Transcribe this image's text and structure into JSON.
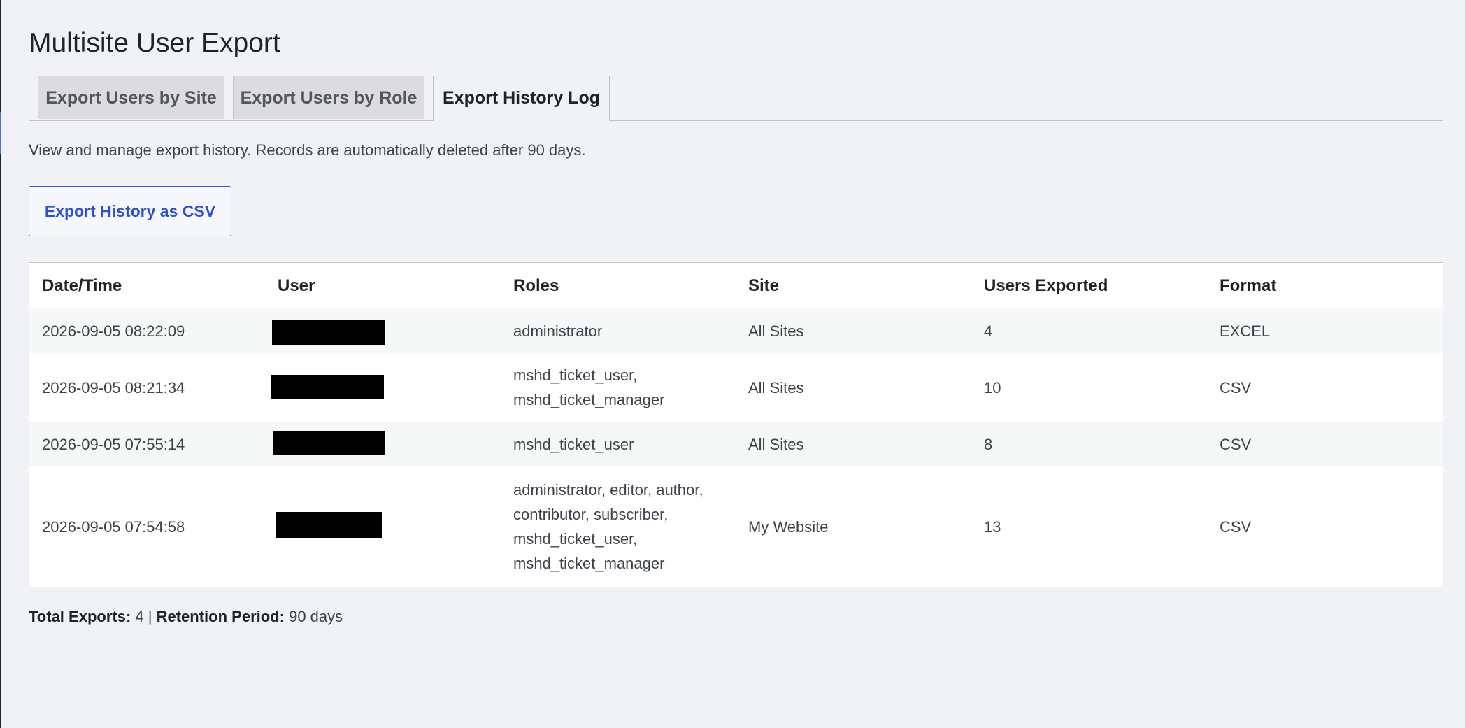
{
  "page_title": "Multisite User Export",
  "tabs": [
    {
      "label": "Export Users by Site",
      "active": false
    },
    {
      "label": "Export Users by Role",
      "active": false
    },
    {
      "label": "Export History Log",
      "active": true
    }
  ],
  "description": "View and manage export history. Records are automatically deleted after 90 days.",
  "export_button_label": "Export History as CSV",
  "table": {
    "headers": [
      "Date/Time",
      "User",
      "Roles",
      "Site",
      "Users Exported",
      "Format"
    ],
    "rows": [
      {
        "datetime": "2026-09-05 08:22:09",
        "user": "[redacted]",
        "roles": "administrator",
        "site": "All Sites",
        "users_exported": "4",
        "format": "EXCEL"
      },
      {
        "datetime": "2026-09-05 08:21:34",
        "user": "[redacted]",
        "roles": "mshd_ticket_user, mshd_ticket_manager",
        "site": "All Sites",
        "users_exported": "10",
        "format": "CSV"
      },
      {
        "datetime": "2026-09-05 07:55:14",
        "user": "[redacted]",
        "roles": "mshd_ticket_user",
        "site": "All Sites",
        "users_exported": "8",
        "format": "CSV"
      },
      {
        "datetime": "2026-09-05 07:54:58",
        "user": "[redacted]",
        "roles": "administrator, editor, author, contributor, subscriber, mshd_ticket_user, mshd_ticket_manager",
        "site": "My Website",
        "users_exported": "13",
        "format": "CSV"
      }
    ]
  },
  "footer": {
    "total_label": "Total Exports:",
    "total_value": "4",
    "separator": "|",
    "retention_label": "Retention Period:",
    "retention_value": "90 days"
  }
}
